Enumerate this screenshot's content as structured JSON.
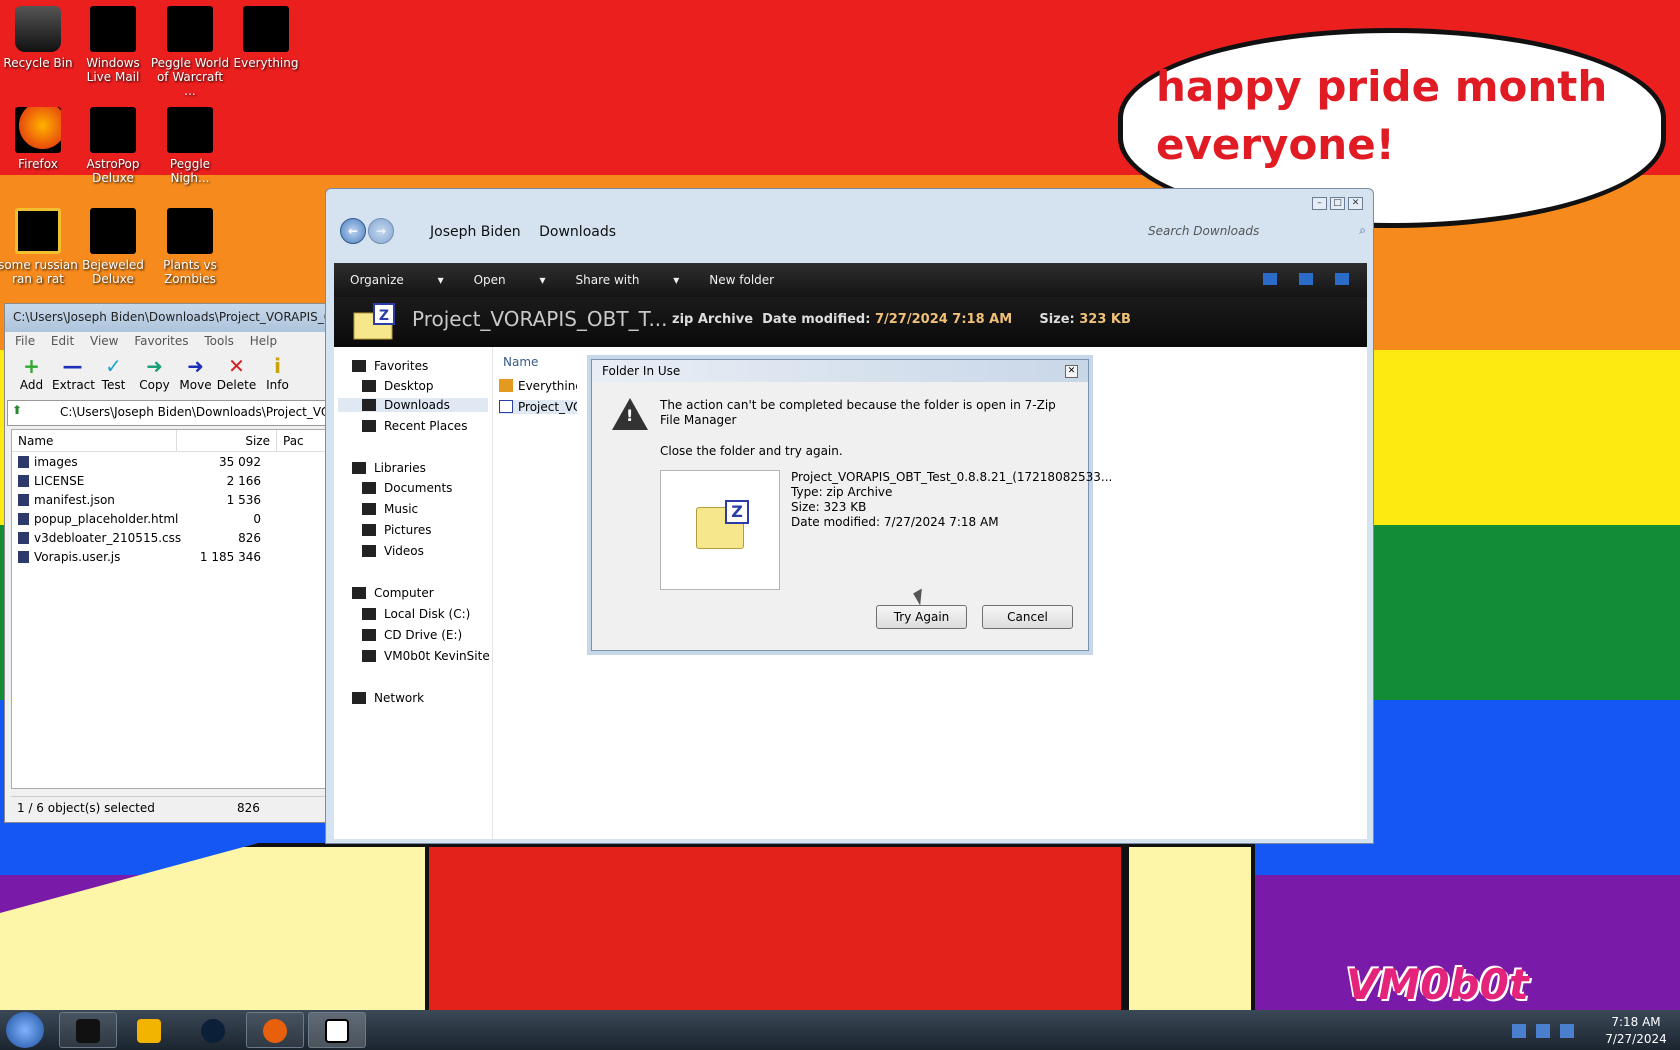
{
  "wallpaper": {
    "bubble_line1": "happy pride month",
    "bubble_line2": "everyone!",
    "signature": "VM0b0t"
  },
  "desktop_icons": [
    {
      "label": "Recycle Bin"
    },
    {
      "label": "Windows Live Mail"
    },
    {
      "label": "Peggle World of Warcraft ..."
    },
    {
      "label": "Everything"
    },
    {
      "label": "Firefox"
    },
    {
      "label": "AstroPop Deluxe"
    },
    {
      "label": "Peggle Nigh..."
    },
    {
      "label": "some russian ran a rat"
    },
    {
      "label": "Bejeweled Deluxe"
    },
    {
      "label": "Plants vs Zombies"
    }
  ],
  "zip_manager": {
    "title": "C:\\Users\\Joseph Biden\\Downloads\\Project_VORAPIS_OI",
    "menu": [
      "File",
      "Edit",
      "View",
      "Favorites",
      "Tools",
      "Help"
    ],
    "toolbar": [
      {
        "label": "Add",
        "glyph": "+",
        "color": "#2ea82e"
      },
      {
        "label": "Extract",
        "glyph": "—",
        "color": "#1b2fb8"
      },
      {
        "label": "Test",
        "glyph": "✓",
        "color": "#1aa6c9"
      },
      {
        "label": "Copy",
        "glyph": "➜",
        "color": "#17a07a"
      },
      {
        "label": "Move",
        "glyph": "➜",
        "color": "#1b2fb8"
      },
      {
        "label": "Delete",
        "glyph": "✕",
        "color": "#d51e1e"
      },
      {
        "label": "Info",
        "glyph": "i",
        "color": "#c9a400"
      }
    ],
    "path": "C:\\Users\\Joseph Biden\\Downloads\\Project_VORA",
    "columns": [
      "Name",
      "Size",
      "Pac"
    ],
    "files": [
      {
        "name": "images",
        "size": "35 092"
      },
      {
        "name": "LICENSE",
        "size": "2 166"
      },
      {
        "name": "manifest.json",
        "size": "1 536"
      },
      {
        "name": "popup_placeholder.html",
        "size": "0"
      },
      {
        "name": "v3debloater_210515.css",
        "size": "826"
      },
      {
        "name": "Vorapis.user.js",
        "size": "1 185 346"
      }
    ],
    "status_selected": "1 / 6 object(s) selected",
    "status_size": "826"
  },
  "explorer": {
    "breadcrumb": [
      "Joseph Biden",
      "Downloads"
    ],
    "search_placeholder": "Search Downloads",
    "commands": [
      "Organize",
      "Open",
      "Share with",
      "New folder"
    ],
    "detail_name": "Project_VORAPIS_OBT_T...",
    "detail_type": "zip Archive",
    "detail_date_label": "Date modified:",
    "detail_date": "7/27/2024 7:18 AM",
    "detail_size_label": "Size:",
    "detail_size": "323 KB",
    "nav": {
      "favorites": "Favorites",
      "desktop": "Desktop",
      "downloads": "Downloads",
      "recent": "Recent Places",
      "libraries": "Libraries",
      "documents": "Documents",
      "music": "Music",
      "pictures": "Pictures",
      "videos": "Videos",
      "computer": "Computer",
      "local_disk": "Local Disk (C:)",
      "cd_drive": "CD Drive (E:)",
      "kevinsite": "VM0b0t KevinSite",
      "network": "Network"
    },
    "column_name": "Name",
    "files": [
      "Everything-",
      "Project_VO"
    ]
  },
  "dialog": {
    "title": "Folder In Use",
    "message": "The action can't be completed because the folder is open in 7-Zip File Manager",
    "instruction": "Close the folder and try again.",
    "file_name": "Project_VORAPIS_OBT_Test_0.8.8.21_(17218082533...",
    "file_type": "Type: zip Archive",
    "file_size": "Size: 323 KB",
    "file_date": "Date modified: 7/27/2024 7:18 AM",
    "try_again": "Try Again",
    "cancel": "Cancel"
  },
  "taskbar": {
    "time": "7:18 AM",
    "date": "7/27/2024"
  }
}
